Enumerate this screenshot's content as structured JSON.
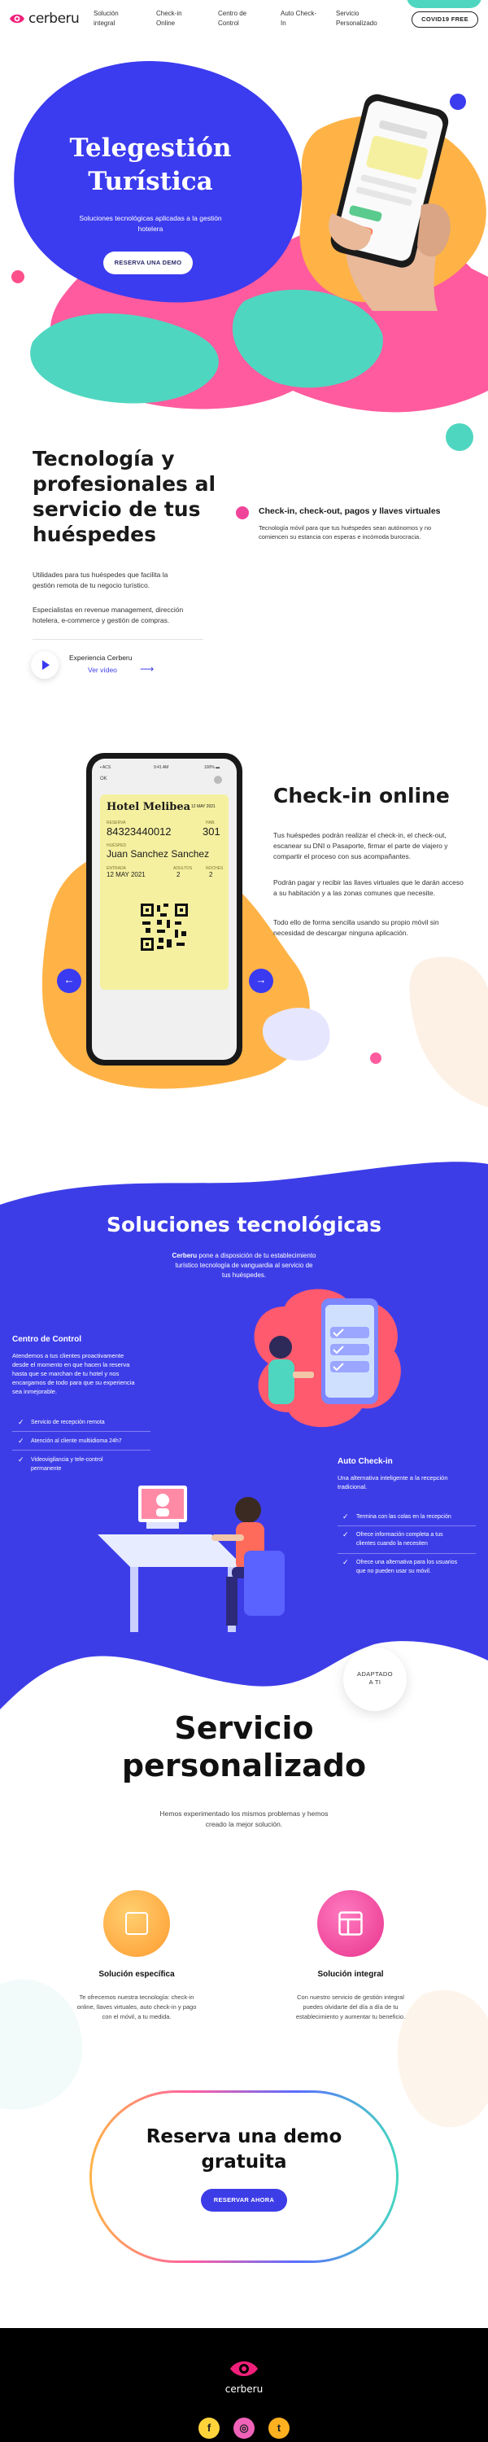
{
  "brand": {
    "name": "cerberu",
    "accent": "#3d3de8"
  },
  "nav": {
    "items": [
      {
        "line1": "Solución",
        "line2": "integral"
      },
      {
        "line1": "Check-in",
        "line2": "Online"
      },
      {
        "line1": "Centro de",
        "line2": "Control"
      },
      {
        "line1": "Auto Check-",
        "line2": "In"
      },
      {
        "line1": "Servicio",
        "line2": "Personalizado"
      }
    ],
    "covid_button": "COVID19 FREE"
  },
  "hero": {
    "title_line1": "Telegestión",
    "title_line2": "Turística",
    "subtitle_line1": "Soluciones tecnológicas aplicadas a la gestión",
    "subtitle_line2": "hotelera",
    "cta": "RESERVA UNA DEMO"
  },
  "intro": {
    "title_lines": [
      "Tecnología y",
      "profesionales al",
      "servicio de tus",
      "huéspedes"
    ],
    "p1_lines": [
      "Utilidades para tus huéspedes que facilita la",
      "gestión remota de tu negocio turístico."
    ],
    "p2_lines": [
      "Especialistas en revenue management, dirección",
      "hotelera, e-commerce y gestión de compras."
    ],
    "video_label": "Experiencia Cerberu",
    "video_link": "Ver vídeo",
    "arrow": "⟶",
    "feature_title": "Check-in, check-out, pagos y llaves virtuales",
    "feature_text_lines": [
      "Tecnología móvil para que tus huéspedes sean autónomos y no",
      "comiencen su estancia con esperas e incómoda burocracia."
    ]
  },
  "checkin": {
    "title": "Check-in online",
    "p1_lines": [
      "Tus huéspedes podrán realizar el check-in, el check-out,",
      "escanear su DNI o Pasaporte, firmar el parte de viajero y",
      "compartir el proceso con sus acompañantes."
    ],
    "p2_lines": [
      "Podrán pagar y recibir las llaves virtuales que le darán acceso",
      "a su habitación y a las zonas comunes que necesite."
    ],
    "p3_lines": [
      "Todo ello de forma sencilla usando su propio móvil sin",
      "necesidad de descargar ninguna aplicación."
    ],
    "prev_icon": "←",
    "next_icon": "→",
    "phone": {
      "status_left": "▪ ACS",
      "status_time": "9:41 AM",
      "status_right": "100% ▬",
      "top_left": "OK",
      "hotel": "Hotel Melibea",
      "date_small": "12 MAY 2021",
      "booking_label": "RESERVA",
      "booking": "84323440012",
      "room_label": "HAB.",
      "room": "301",
      "guest_label": "HUÉSPED",
      "guest": "Juan Sanchez Sanchez",
      "checkin_label": "ENTRADA",
      "checkin": "12 MAY 2021",
      "adults_label": "ADULTOS",
      "adults": "2",
      "kids_label": "NOCHES",
      "kids": "2"
    }
  },
  "soluciones": {
    "title": "Soluciones tecnológicas",
    "sub_brand": "Cerberu",
    "sub_lines": [
      "pone a disposición de tu establecimiento",
      "turístico tecnología de vanguardia al servicio de",
      "tus huéspedes."
    ],
    "control": {
      "title": "Centro de Control",
      "text_lines": [
        "Atendemos a tus clientes proactivamente",
        "desde el momento en que hacen la reserva",
        "hasta que se marchan de tu hotel y nos",
        "encargamos de todo para que su experiencia",
        "sea inmejorable."
      ],
      "items": [
        {
          "lines": [
            "Servicio de recepción remota"
          ]
        },
        {
          "lines": [
            "Atención al cliente multiidioma 24h7"
          ]
        },
        {
          "lines": [
            "Videovigilancia y tele-control",
            "permanente"
          ]
        }
      ]
    },
    "auto": {
      "title": "Auto Check-in",
      "text_lines": [
        "Una alternativa inteligente a la recepción",
        "tradicional."
      ],
      "items": [
        {
          "lines": [
            "Termina con las colas en la recepción"
          ]
        },
        {
          "lines": [
            "Ofrece información completa a tus",
            "clientes cuando la necesiten"
          ]
        },
        {
          "lines": [
            "Ofrece una alternativa para los usuarios",
            "que no pueden usar su móvil."
          ]
        }
      ]
    }
  },
  "adaptado": {
    "line1": "ADAPTADO",
    "line2": "A TI"
  },
  "servicio": {
    "title_line1": "Servicio",
    "title_line2": "personalizado",
    "sub_lines": [
      "Hemos experimentado los mismos problemas y hemos",
      "creado la mejor solución."
    ],
    "cards": [
      {
        "title": "Solución específica",
        "text_lines": [
          "Te ofrecemos nuestra tecnología: check-in",
          "online, llaves virtuales, auto check-in y pago",
          "con el móvil, a tu medida."
        ],
        "icon": "square-icon",
        "color": "#ffa733"
      },
      {
        "title": "Solución integral",
        "text_lines": [
          "Con nuestro servicio de gestión integral",
          "puedes olvidarte del día a día de tu",
          "establecimiento y aumentar tu beneficio."
        ],
        "icon": "layout-icon",
        "color": "#f0449a"
      }
    ]
  },
  "demo": {
    "title_line1": "Reserva una demo",
    "title_line2": "gratuita",
    "button": "RESERVAR AHORA"
  },
  "footer": {
    "brand": "cerberu",
    "social": [
      {
        "icon": "facebook-icon",
        "glyph": "f",
        "color": "#ffd43b"
      },
      {
        "icon": "instagram-icon",
        "glyph": "◎",
        "color": "#f062b8"
      },
      {
        "icon": "twitter-icon",
        "glyph": "t",
        "color": "#ffb020"
      }
    ]
  }
}
